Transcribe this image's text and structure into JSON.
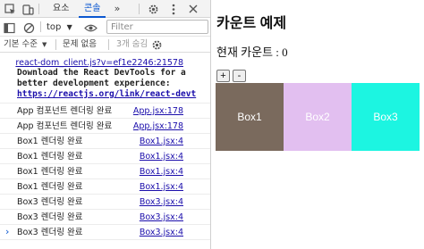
{
  "devtools": {
    "tabs": [
      {
        "label": "요소"
      },
      {
        "label": "콘솔",
        "active": true
      }
    ],
    "more_tabs_label": "»",
    "context_select": {
      "value": "top"
    },
    "filter": {
      "placeholder": "Filter"
    },
    "levels_label": "기본 수준",
    "issues_label": "문제 없음",
    "hidden_count_label": "3개 숨김",
    "accent_color": "#0b57d0",
    "icons": [
      "inspect-icon",
      "device-toolbar-icon",
      "settings-icon",
      "kebab-menu-icon",
      "close-icon",
      "sidebar-icon",
      "clear-console-icon",
      "eye-icon",
      "dropdown-icon",
      "gear-icon"
    ]
  },
  "console": {
    "entries": [
      {
        "text": "",
        "source": "react-dom_client.js?v=ef1e2246:21578"
      },
      {
        "text": "Download the React DevTools for a",
        "source": ""
      },
      {
        "text": "better development experience:",
        "source": ""
      },
      {
        "text": "https://reactjs.org/link/react-devt",
        "source": ""
      },
      {
        "text": "App 컴포넌트 렌더링 완료",
        "source": "App.jsx:178"
      },
      {
        "text": "App 컴포넌트 렌더링 완료",
        "source": "App.jsx:178"
      },
      {
        "text": "Box1 렌더링 완료",
        "source": "Box1.jsx:4"
      },
      {
        "text": "Box1 렌더링 완료",
        "source": "Box1.jsx:4"
      },
      {
        "text": "Box1 렌더링 완료",
        "source": "Box1.jsx:4"
      },
      {
        "text": "Box1 렌더링 완료",
        "source": "Box1.jsx:4"
      },
      {
        "text": "Box3 렌더링 완료",
        "source": "Box3.jsx:4"
      },
      {
        "text": "Box3 렌더링 완료",
        "source": "Box3.jsx:4"
      },
      {
        "text": "Box3 렌더링 완료",
        "source": "Box3.jsx:4"
      }
    ],
    "prompt": "›"
  },
  "page": {
    "title": "카운트 예제",
    "count_label": "현재 카운트 : 0",
    "plus_label": "+",
    "minus_label": "-",
    "boxes": [
      {
        "label": "Box1",
        "color": "#7a6a5d"
      },
      {
        "label": "Box2",
        "color": "#e2bff0"
      },
      {
        "label": "Box3",
        "color": "#1cf5e1"
      }
    ]
  }
}
